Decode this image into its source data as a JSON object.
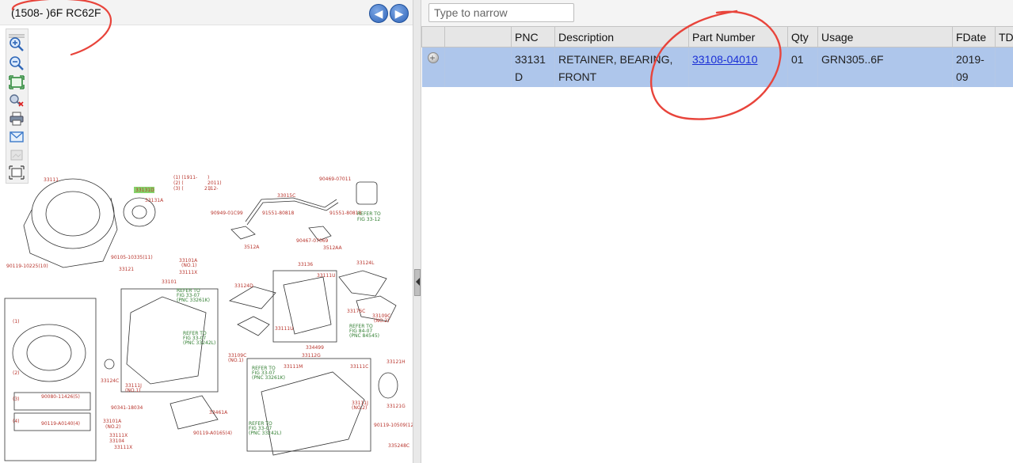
{
  "left_panel": {
    "title": "(1508- )6F RC62F",
    "nav": {
      "back_icon": "arrow-left-icon",
      "forward_icon": "arrow-right-icon"
    },
    "toolbar": [
      "zoom-in-icon",
      "zoom-out-icon",
      "fit-to-window-icon",
      "search-clear-icon",
      "print-icon",
      "email-icon",
      "disabled-tool-icon",
      "fullscreen-icon"
    ],
    "diagram": {
      "highlight_color": "#86d36b",
      "labels": [
        "33111",
        "33131D",
        "33131A",
        "33015C",
        "90469-07011",
        "90949-01C99",
        "91551-80818",
        "91551-80818",
        "90467-07069",
        "REFER TO",
        "FIG 33-12",
        "3512A",
        "3512AA",
        "90105-10335(11)",
        "90119-10225(10)",
        "33121",
        "33101A",
        "(NO.1)",
        "33111X",
        "33101",
        "33136",
        "33111U",
        "33124L",
        "33124D",
        "33176C",
        "33109C",
        "(NO.2)",
        "REFER TO",
        "FIG 33-07",
        "(PNC 33261K)",
        "REFER TO",
        "FIG 33-07",
        "(PNC 33242L)",
        "33111U",
        "REFER TO",
        "FIG 84-07",
        "(PNC 84545)",
        "33109C",
        "(NO.1)",
        "334499",
        "33112G",
        "33111M",
        "33111C",
        "33121H",
        "33124C",
        "33111J",
        "(NO.1)",
        "33111J",
        "(NO.2)",
        "33121G",
        "90080-11426(5)",
        "90119-A0140(4)",
        "90119-10509(12)",
        "33101A",
        "(NO.2)",
        "33111X",
        "33104",
        "33111X",
        "33461A",
        "90119-A0165(4)",
        "REFER TO",
        "FIG 33-07",
        "(PNC 33261K)",
        "REFER TO",
        "FIG 33-07",
        "(PNC 33242L)",
        "90341-18034",
        "335248C",
        "(1)",
        "(2)",
        "(3)",
        "(4)",
        "(1) (1911-",
        ")",
        "(2) (",
        "2011)",
        "(3) (",
        "2112-",
        ")"
      ]
    }
  },
  "right_panel": {
    "search": {
      "placeholder": "Type to narrow",
      "value": ""
    },
    "table": {
      "headers": [
        "",
        "",
        "PNC",
        "Description",
        "Part Number",
        "Qty",
        "Usage",
        "FDate",
        "TD"
      ],
      "rows": [
        {
          "pnc": "33131\nD",
          "description": "RETAINER, BEARING,\nFRONT",
          "part_number": "33108-04010",
          "qty": "01",
          "usage": "GRN305..6F",
          "fdate": "2019-\n09",
          "td": ""
        }
      ],
      "selected_row_color": "#aec6eb"
    }
  },
  "annotation_color": "#e8443b"
}
